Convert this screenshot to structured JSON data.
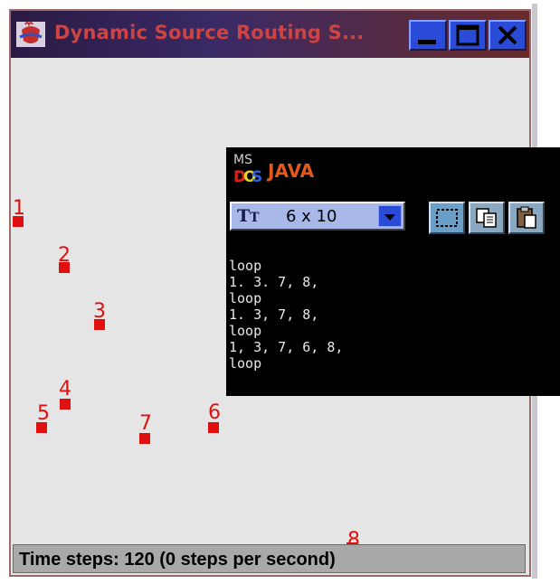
{
  "window": {
    "title": "Dynamic Source Routing S..."
  },
  "status": {
    "text": "Time steps: 120 (0 steps per second)"
  },
  "nodes": [
    {
      "label": "1"
    },
    {
      "label": "2"
    },
    {
      "label": "3"
    },
    {
      "label": "4"
    },
    {
      "label": "5"
    },
    {
      "label": "6"
    },
    {
      "label": "7"
    },
    {
      "label": "8"
    }
  ],
  "console": {
    "title": "JAVA",
    "icon_label": "MS",
    "font_size": "6 x 10",
    "lines": [
      "loop",
      "1. 3. 7, 8,",
      "loop",
      "1. 3, 7, 8,",
      "loop",
      "1, 3, 7, 6, 8,",
      "loop"
    ]
  },
  "colors": {
    "node": "#e01010",
    "canvas": "#e5e5e5",
    "console_bg": "#000000",
    "console_title": "#e05a1a"
  },
  "icons": {
    "app": "java-coffee-cup-icon",
    "minimize": "minimize-icon",
    "maximize": "maximize-icon",
    "close": "close-icon",
    "msdos": "msdos-icon",
    "mark": "mark-icon",
    "copy": "copy-icon",
    "paste": "paste-icon"
  }
}
